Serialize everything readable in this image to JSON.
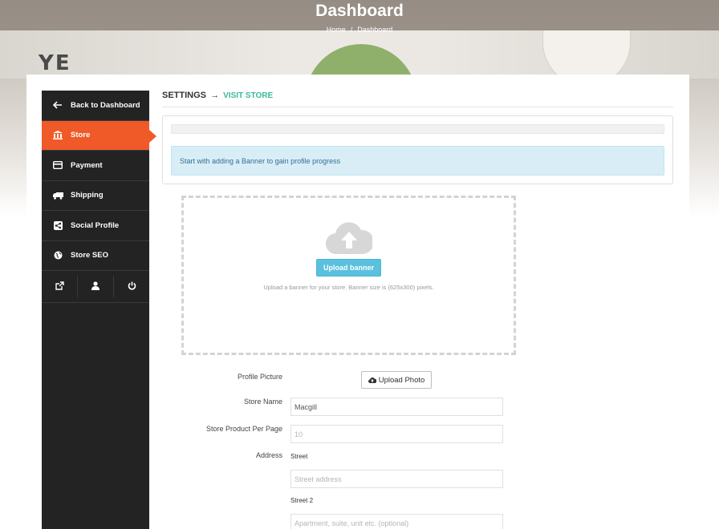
{
  "header": {
    "title": "Dashboard",
    "breadcrumb": {
      "home": "Home",
      "separator": "/",
      "current": "Dashboard"
    },
    "hero_letters": "YE"
  },
  "sidebar": {
    "items": [
      {
        "label": "Back to Dashboard",
        "icon": "arrow-left-icon"
      },
      {
        "label": "Store",
        "icon": "bank-icon",
        "active": true
      },
      {
        "label": "Payment",
        "icon": "credit-card-icon"
      },
      {
        "label": "Shipping",
        "icon": "truck-icon"
      },
      {
        "label": "Social Profile",
        "icon": "share-icon"
      },
      {
        "label": "Store SEO",
        "icon": "globe-icon"
      }
    ],
    "bottom_icons": [
      "external-link-icon",
      "user-icon",
      "power-icon"
    ]
  },
  "settings": {
    "heading": "SETTINGS",
    "arrow": "→",
    "visit_link": "VISIT STORE",
    "alert": "Start with adding a Banner to gain profile progress"
  },
  "banner": {
    "button": "Upload banner",
    "hint": "Upload a banner for your store. Banner size is (625x300) pixels.",
    "icon": "cloud-upload-icon"
  },
  "form": {
    "profile_picture_label": "Profile Picture",
    "upload_photo_button": "Upload Photo",
    "store_name_label": "Store Name",
    "store_name_value": "Macgill",
    "product_per_page_label": "Store Product Per Page",
    "product_per_page_placeholder": "10",
    "address_label": "Address",
    "street_label": "Street",
    "street_placeholder": "Street address",
    "street2_label": "Street 2",
    "street2_placeholder": "Apartment, suite, unit etc. (optional)"
  },
  "colors": {
    "accent": "#f05a28",
    "link": "#3bb99a",
    "info_button": "#5bc0de",
    "sidebar_bg": "#232323"
  }
}
